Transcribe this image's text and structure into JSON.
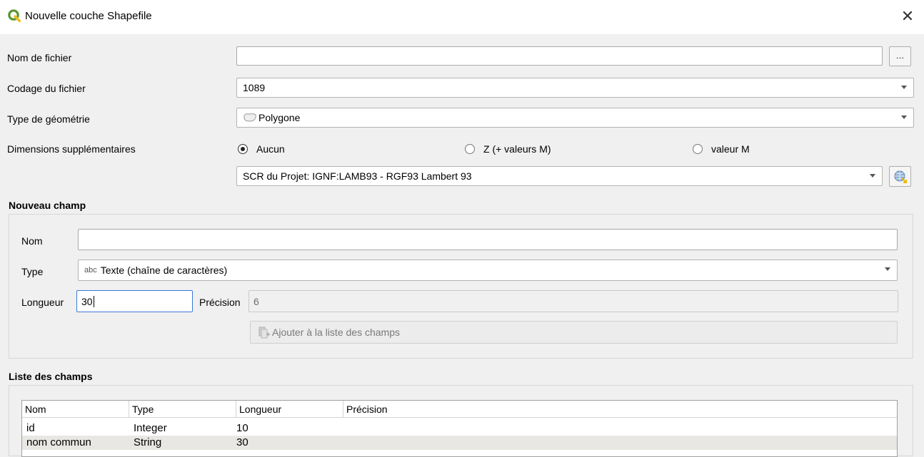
{
  "window": {
    "title": "Nouvelle couche Shapefile",
    "close_label": "✕"
  },
  "form": {
    "filename_label": "Nom de fichier",
    "filename_value": "",
    "browse_label": "…",
    "encoding_label": "Codage du fichier",
    "encoding_value": "1089",
    "geometry_label": "Type de géométrie",
    "geometry_value": "Polygone",
    "dimensions_label": "Dimensions supplémentaires",
    "dimensions_options": [
      "Aucun",
      "Z (+ valeurs M)",
      "valeur M"
    ],
    "dimensions_selected": "Aucun",
    "crs_value": "SCR du Projet: IGNF:LAMB93 - RGF93 Lambert 93"
  },
  "new_field": {
    "title": "Nouveau champ",
    "name_label": "Nom",
    "name_value": "",
    "type_label": "Type",
    "type_icon_text": "abc",
    "type_value": "Texte (chaîne de caractères)",
    "length_label": "Longueur",
    "length_value": "30",
    "precision_label": "Précision",
    "precision_value": "6",
    "add_button_label": "Ajouter à la liste des champs"
  },
  "field_list": {
    "title": "Liste des champs",
    "columns": [
      "Nom",
      "Type",
      "Longueur",
      "Précision"
    ],
    "rows": [
      {
        "name": "id",
        "type": "Integer",
        "length": "10",
        "precision": ""
      },
      {
        "name": "nom commun",
        "type": "String",
        "length": "30",
        "precision": ""
      }
    ]
  },
  "colors": {
    "qgis_green": "#589632",
    "qgis_yellow": "#eebd1b",
    "row_alt": "#e9e7e3"
  }
}
